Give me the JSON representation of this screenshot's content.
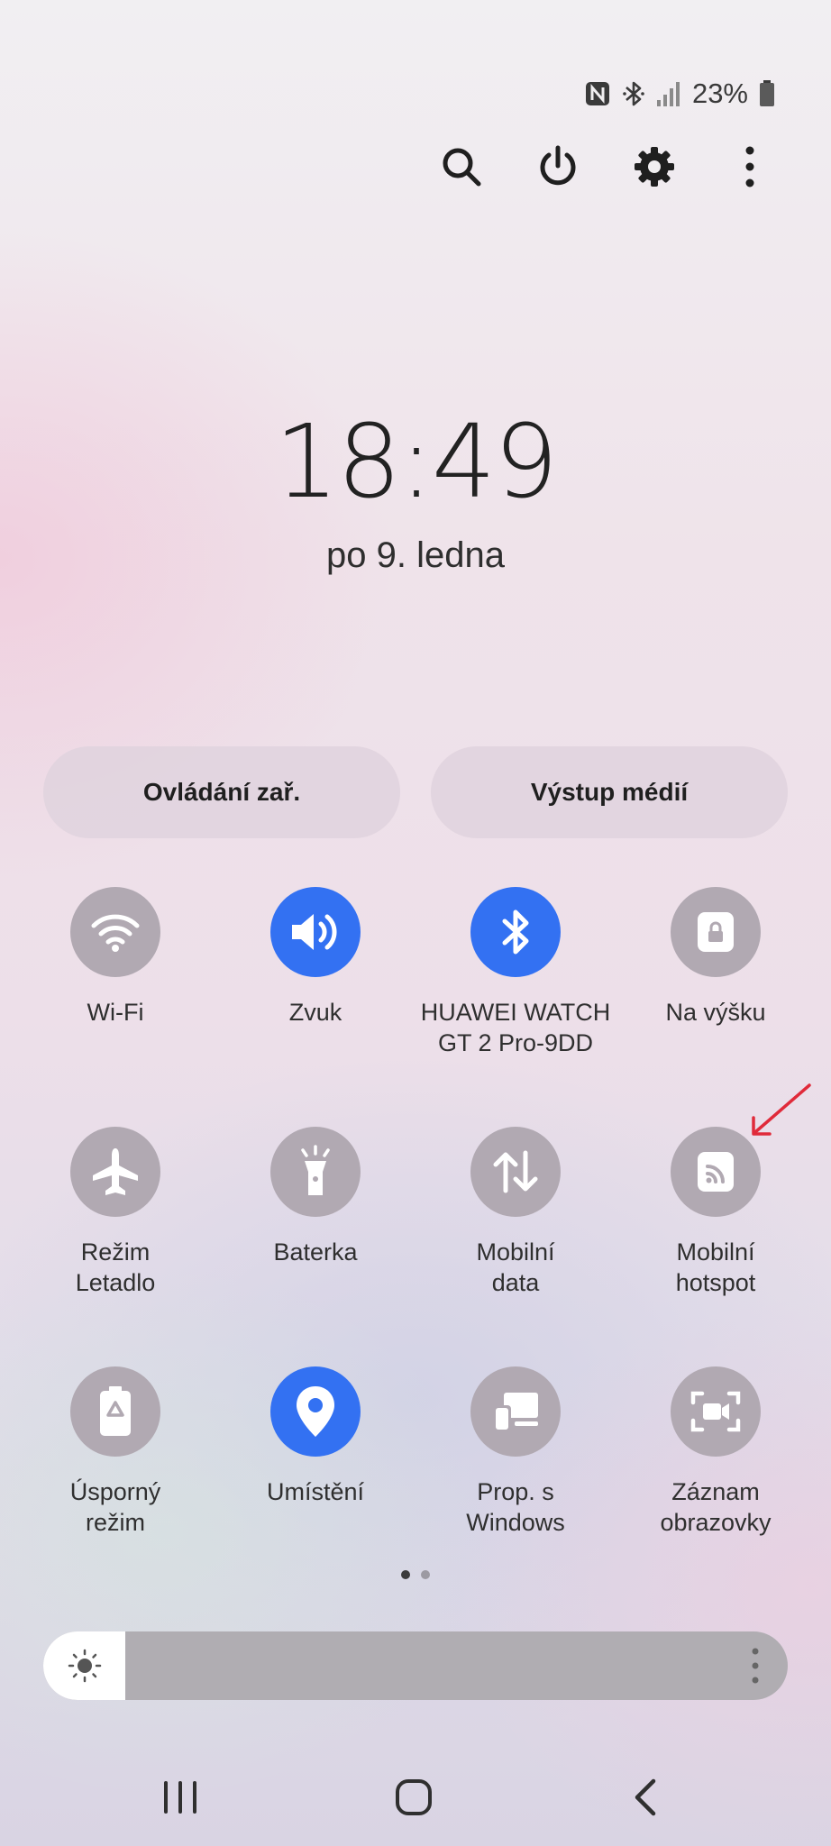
{
  "status_bar": {
    "icons": [
      "nfc-icon",
      "bluetooth-icon",
      "signal-icon",
      "battery-icon"
    ],
    "battery_percent": "23%"
  },
  "top_actions": [
    {
      "name": "search-icon"
    },
    {
      "name": "power-icon"
    },
    {
      "name": "settings-gear-icon"
    },
    {
      "name": "more-vertical-icon"
    }
  ],
  "clock": {
    "time": "18:49",
    "date": "po 9. ledna"
  },
  "quick_buttons": {
    "device_control": "Ovládání zař.",
    "media_output": "Výstup médií"
  },
  "tiles": {
    "wifi": {
      "label": "Wi-Fi",
      "active": false
    },
    "sound": {
      "label": "Zvuk",
      "active": true
    },
    "bluetooth": {
      "label_line1": "HUAWEI WATCH",
      "label_line2": "GT 2 Pro-9DD",
      "active": true
    },
    "portrait_lock": {
      "label": "Na výšku",
      "active": false
    },
    "airplane": {
      "label_line1": "Režim",
      "label_line2": "Letadlo",
      "active": false
    },
    "flashlight": {
      "label": "Baterka",
      "active": false
    },
    "mobile_data": {
      "label_line1": "Mobilní",
      "label_line2": "data",
      "active": false
    },
    "hotspot": {
      "label_line1": "Mobilní",
      "label_line2": "hotspot",
      "active": false
    },
    "power_saving": {
      "label_line1": "Úsporný",
      "label_line2": "režim",
      "active": false
    },
    "location": {
      "label": "Umístění",
      "active": true
    },
    "link_windows": {
      "label_line1": "Prop. s",
      "label_line2": "Windows",
      "active": false
    },
    "screen_recorder": {
      "label_line1": "Záznam",
      "label_line2": "obrazovky",
      "active": false
    }
  },
  "pagination": {
    "pages": 2,
    "current": 1
  },
  "brightness": {
    "level": 0.11
  },
  "colors": {
    "accent": "#3371f2",
    "tile_off": "#b1a9b2",
    "annotation_arrow": "#e02a3a"
  },
  "nav_bar": [
    "recents-icon",
    "home-icon",
    "back-icon"
  ]
}
